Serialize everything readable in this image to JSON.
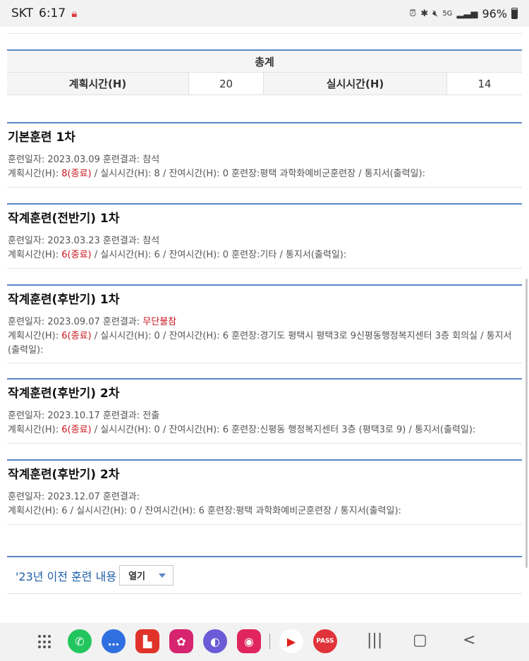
{
  "status_bar": {
    "carrier": "SKT",
    "time": "6:17",
    "battery": "96%"
  },
  "summary": {
    "title": "총계",
    "planned_label": "계획시간(H)",
    "planned_value": "20",
    "actual_label": "실시시간(H)",
    "actual_value": "14"
  },
  "records": [
    {
      "title": "기본훈련 1차",
      "date_text": "훈련일자: 2023.03.09 훈련결과: ",
      "result": "참석",
      "plan_prefix": "계획시간(H): ",
      "plan_red": "8(종료)",
      "rest": " / 실시시간(H): 8 / 잔여시간(H): 0 훈련장:평택 과학화예비군훈련장 / 통지서(출력일):"
    },
    {
      "title": "작계훈련(전반기) 1차",
      "date_text": "훈련일자: 2023.03.23 훈련결과: ",
      "result": "참석",
      "plan_prefix": "계획시간(H): ",
      "plan_red": "6(종료)",
      "rest": " / 실시시간(H): 6 / 잔여시간(H): 0 훈련장:기타 / 통지서(출력일):"
    },
    {
      "title": "작계훈련(후반기) 1차",
      "date_text": "훈련일자: 2023.09.07 훈련결과: ",
      "result": "무단불참",
      "plan_prefix": "계획시간(H): ",
      "plan_red": "6(종료)",
      "rest": " / 실시시간(H): 0 / 잔여시간(H): 6 훈련장:경기도 평택시 평택3로 9신평동행정복지센터 3층 회의실 / 통지서(출력일):"
    },
    {
      "title": "작계훈련(후반기) 2차",
      "date_text": "훈련일자: 2023.10.17 훈련결과: ",
      "result": "전출",
      "plan_prefix": "계획시간(H): ",
      "plan_red": "6(종료)",
      "rest": " / 실시시간(H): 0 / 잔여시간(H): 6 훈련장:신평동 행정복지센터 3층 (평택3로 9) / 통지서(출력일):"
    },
    {
      "title": "작계훈련(후반기) 2차",
      "date_text": "훈련일자: 2023.12.07 훈련결과: ",
      "result": "",
      "plan_prefix": "계획시간(H): 6",
      "plan_red": "",
      "rest": " / 실시시간(H): 0 / 잔여시간(H): 6 훈련장:평택 과학화예비군훈련장 / 통지서(출력일):"
    }
  ],
  "previous": {
    "label": "'23년 이전 훈련 내용",
    "select_value": "열기"
  },
  "nav": {
    "apps": [
      "phone",
      "messages",
      "flipboard",
      "gallery",
      "internet",
      "camera",
      "youtube",
      "PASS"
    ],
    "pass_label": "PASS"
  }
}
